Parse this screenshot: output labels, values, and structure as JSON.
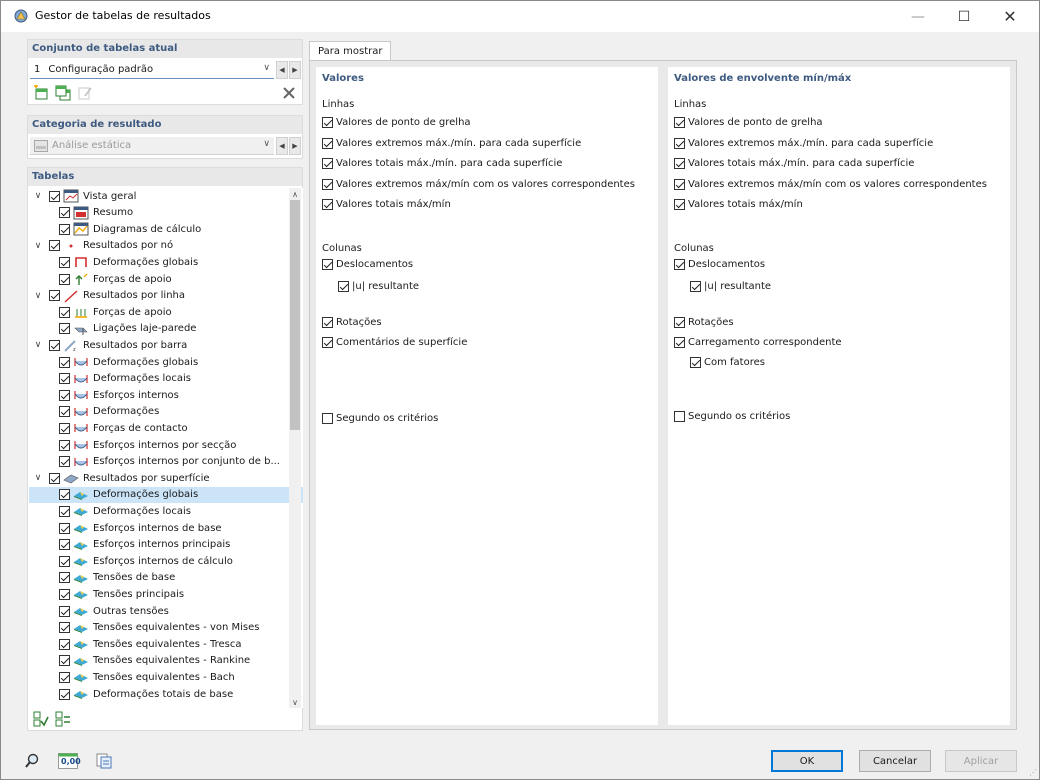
{
  "window": {
    "title": "Gestor de tabelas de resultados",
    "minimize": "—",
    "maximize": "☐",
    "close": "✕"
  },
  "current_set": {
    "header": "Conjunto de tabelas atual",
    "number": "1",
    "value": "Configuração padrão"
  },
  "category": {
    "header": "Categoria de resultado",
    "value": "Análise estática"
  },
  "tables": {
    "header": "Tabelas",
    "rows": [
      {
        "label": "Vista geral",
        "level": 0,
        "expander": "∨",
        "icon": "overview-icon",
        "selected": false
      },
      {
        "label": "Resumo",
        "level": 1,
        "expander": "",
        "icon": "summary-icon",
        "selected": false
      },
      {
        "label": "Diagramas de cálculo",
        "level": 1,
        "expander": "",
        "icon": "diagram-icon",
        "selected": false
      },
      {
        "label": "Resultados por nó",
        "level": 0,
        "expander": "∨",
        "icon": "node-icon",
        "selected": false
      },
      {
        "label": "Deformações globais",
        "level": 1,
        "expander": "",
        "icon": "node-deformation-icon",
        "selected": false
      },
      {
        "label": "Forças de apoio",
        "level": 1,
        "expander": "",
        "icon": "support-force-icon",
        "selected": false
      },
      {
        "label": "Resultados por linha",
        "level": 0,
        "expander": "∨",
        "icon": "line-icon",
        "selected": false
      },
      {
        "label": "Forças de apoio",
        "level": 1,
        "expander": "",
        "icon": "line-support-icon",
        "selected": false
      },
      {
        "label": "Ligações laje-parede",
        "level": 1,
        "expander": "",
        "icon": "slab-wall-icon",
        "selected": false
      },
      {
        "label": "Resultados por barra",
        "level": 0,
        "expander": "∨",
        "icon": "member-icon",
        "selected": false
      },
      {
        "label": "Deformações globais",
        "level": 1,
        "expander": "",
        "icon": "member-result-icon",
        "selected": false
      },
      {
        "label": "Deformações locais",
        "level": 1,
        "expander": "",
        "icon": "member-result-icon",
        "selected": false
      },
      {
        "label": "Esforços internos",
        "level": 1,
        "expander": "",
        "icon": "member-result-icon",
        "selected": false
      },
      {
        "label": "Deformações",
        "level": 1,
        "expander": "",
        "icon": "member-result-icon",
        "selected": false
      },
      {
        "label": "Forças de contacto",
        "level": 1,
        "expander": "",
        "icon": "member-result-icon",
        "selected": false
      },
      {
        "label": "Esforços internos por secção",
        "level": 1,
        "expander": "",
        "icon": "member-result-icon",
        "selected": false
      },
      {
        "label": "Esforços internos por conjunto de b...",
        "level": 1,
        "expander": "",
        "icon": "member-result-icon",
        "selected": false
      },
      {
        "label": "Resultados por superfície",
        "level": 0,
        "expander": "∨",
        "icon": "surface-icon",
        "selected": false
      },
      {
        "label": "Deformações globais",
        "level": 1,
        "expander": "",
        "icon": "surface-result-icon",
        "selected": true
      },
      {
        "label": "Deformações locais",
        "level": 1,
        "expander": "",
        "icon": "surface-result-icon",
        "selected": false
      },
      {
        "label": "Esforços internos de base",
        "level": 1,
        "expander": "",
        "icon": "surface-result-icon",
        "selected": false
      },
      {
        "label": "Esforços internos principais",
        "level": 1,
        "expander": "",
        "icon": "surface-result-icon",
        "selected": false
      },
      {
        "label": "Esforços internos de cálculo",
        "level": 1,
        "expander": "",
        "icon": "surface-result-icon",
        "selected": false
      },
      {
        "label": "Tensões de base",
        "level": 1,
        "expander": "",
        "icon": "surface-result-icon",
        "selected": false
      },
      {
        "label": "Tensões principais",
        "level": 1,
        "expander": "",
        "icon": "surface-result-icon",
        "selected": false
      },
      {
        "label": "Outras tensões",
        "level": 1,
        "expander": "",
        "icon": "surface-result-icon",
        "selected": false
      },
      {
        "label": "Tensões equivalentes - von Mises",
        "level": 1,
        "expander": "",
        "icon": "surface-result-icon",
        "selected": false
      },
      {
        "label": "Tensões equivalentes - Tresca",
        "level": 1,
        "expander": "",
        "icon": "surface-result-icon",
        "selected": false
      },
      {
        "label": "Tensões equivalentes - Rankine",
        "level": 1,
        "expander": "",
        "icon": "surface-result-icon",
        "selected": false
      },
      {
        "label": "Tensões equivalentes - Bach",
        "level": 1,
        "expander": "",
        "icon": "surface-result-icon",
        "selected": false
      },
      {
        "label": "Deformações totais de base",
        "level": 1,
        "expander": "",
        "icon": "surface-result-icon",
        "selected": false
      }
    ]
  },
  "tab": {
    "label": "Para mostrar"
  },
  "values_col": {
    "title": "Valores",
    "rows_title": "Linhas",
    "rows": [
      {
        "label": "Valores de ponto de grelha",
        "checked": true
      },
      {
        "label": "Valores extremos máx./mín. para cada superfície",
        "checked": true
      },
      {
        "label": "Valores totais máx./mín. para cada superfície",
        "checked": true
      },
      {
        "label": "Valores extremos máx/mín com os valores correspondentes",
        "checked": true
      },
      {
        "label": "Valores totais máx/mín",
        "checked": true
      }
    ],
    "cols_title": "Colunas",
    "cols": [
      {
        "label": "Deslocamentos",
        "checked": true,
        "indent": false
      },
      {
        "label": "|u| resultante",
        "checked": true,
        "indent": true
      },
      {
        "label": "Rotações",
        "checked": true,
        "indent": false
      },
      {
        "label": "Comentários de superfície",
        "checked": true,
        "indent": false
      }
    ],
    "criteria": {
      "label": "Segundo os critérios",
      "checked": false
    }
  },
  "envelope_col": {
    "title": "Valores de envolvente mín/máx",
    "rows_title": "Linhas",
    "rows": [
      {
        "label": "Valores de ponto de grelha",
        "checked": true
      },
      {
        "label": "Valores extremos máx./mín. para cada superfície",
        "checked": true
      },
      {
        "label": "Valores totais máx./mín. para cada superfície",
        "checked": true
      },
      {
        "label": "Valores extremos máx/mín com os valores correspondentes",
        "checked": true
      },
      {
        "label": "Valores totais máx/mín",
        "checked": true
      }
    ],
    "cols_title": "Colunas",
    "cols": [
      {
        "label": "Deslocamentos",
        "checked": true,
        "indent": false
      },
      {
        "label": "|u| resultante",
        "checked": true,
        "indent": true
      },
      {
        "label": "Rotações",
        "checked": true,
        "indent": false
      },
      {
        "label": "Carregamento correspondente",
        "checked": true,
        "indent": false
      },
      {
        "label": "Com fatores",
        "checked": true,
        "indent": true
      }
    ],
    "criteria": {
      "label": "Segundo os critérios",
      "checked": false
    }
  },
  "footer": {
    "decimals_label": "0,00",
    "ok": "OK",
    "cancel": "Cancelar",
    "apply": "Aplicar"
  },
  "colors": {
    "accent_header": "#3d5a80",
    "selection": "#cce4f7",
    "ok_border": "#0078d7"
  }
}
